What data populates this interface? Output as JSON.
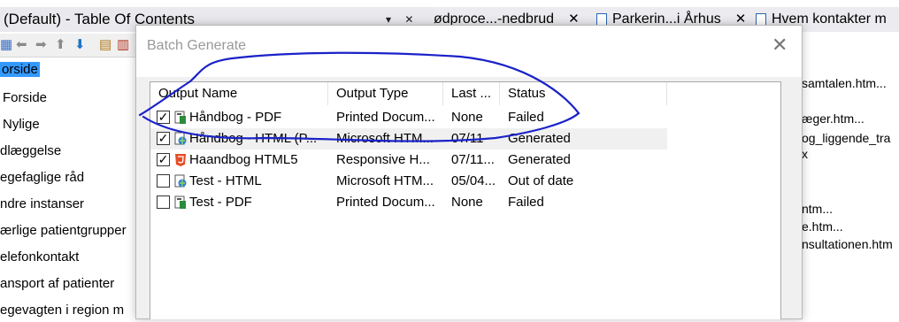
{
  "toc": {
    "title": "(Default) - Table Of Contents",
    "window_controls": "▾ ✕ ✕",
    "items": [
      {
        "label": "orside",
        "selected": true
      },
      {
        "label": "Forside"
      },
      {
        "label": "Nylige"
      },
      {
        "label": "dlæggelse"
      },
      {
        "label": "egefaglige råd"
      },
      {
        "label": "ndre instanser"
      },
      {
        "label": "ærlige patientgrupper"
      },
      {
        "label": "elefonkontakt"
      },
      {
        "label": "ansport af patienter"
      },
      {
        "label": "egevagten i region m"
      }
    ]
  },
  "tabs": [
    {
      "label": "ødproce...-nedbrud"
    },
    {
      "label": "Parkerin...i Århus"
    },
    {
      "label": "Hvem kontakter m"
    }
  ],
  "right_files": [
    "samtalen.htm...",
    "æger.htm...",
    "og_liggende_tra",
    "x",
    "ntm...",
    "e.htm...",
    "nsultationen.htm"
  ],
  "dialog": {
    "title": "Batch Generate",
    "columns": [
      "Output Name",
      "Output Type",
      "Last ...",
      "Status"
    ],
    "rows": [
      {
        "checked": true,
        "name": "Håndbog  - PDF",
        "type": "Printed Docum...",
        "last": "None",
        "status": "Failed",
        "icon": "pdf-output-icon"
      },
      {
        "checked": true,
        "name": "Håndbog - HTML (P...",
        "type": "Microsoft HTM...",
        "last": "07/11",
        "status": "Generated",
        "icon": "html-help-output-icon"
      },
      {
        "checked": true,
        "name": "Haandbog HTML5",
        "type": "Responsive H...",
        "last": "07/11...",
        "status": "Generated",
        "icon": "html5-output-icon"
      },
      {
        "checked": false,
        "name": "Test - HTML",
        "type": "Microsoft HTM...",
        "last": "05/04...",
        "status": "Out of date",
        "icon": "html-help-output-icon"
      },
      {
        "checked": false,
        "name": "Test - PDF",
        "type": "Printed Docum...",
        "last": "None",
        "status": "Failed",
        "icon": "pdf-output-icon"
      }
    ]
  },
  "annotation_color": "#1a22c8"
}
